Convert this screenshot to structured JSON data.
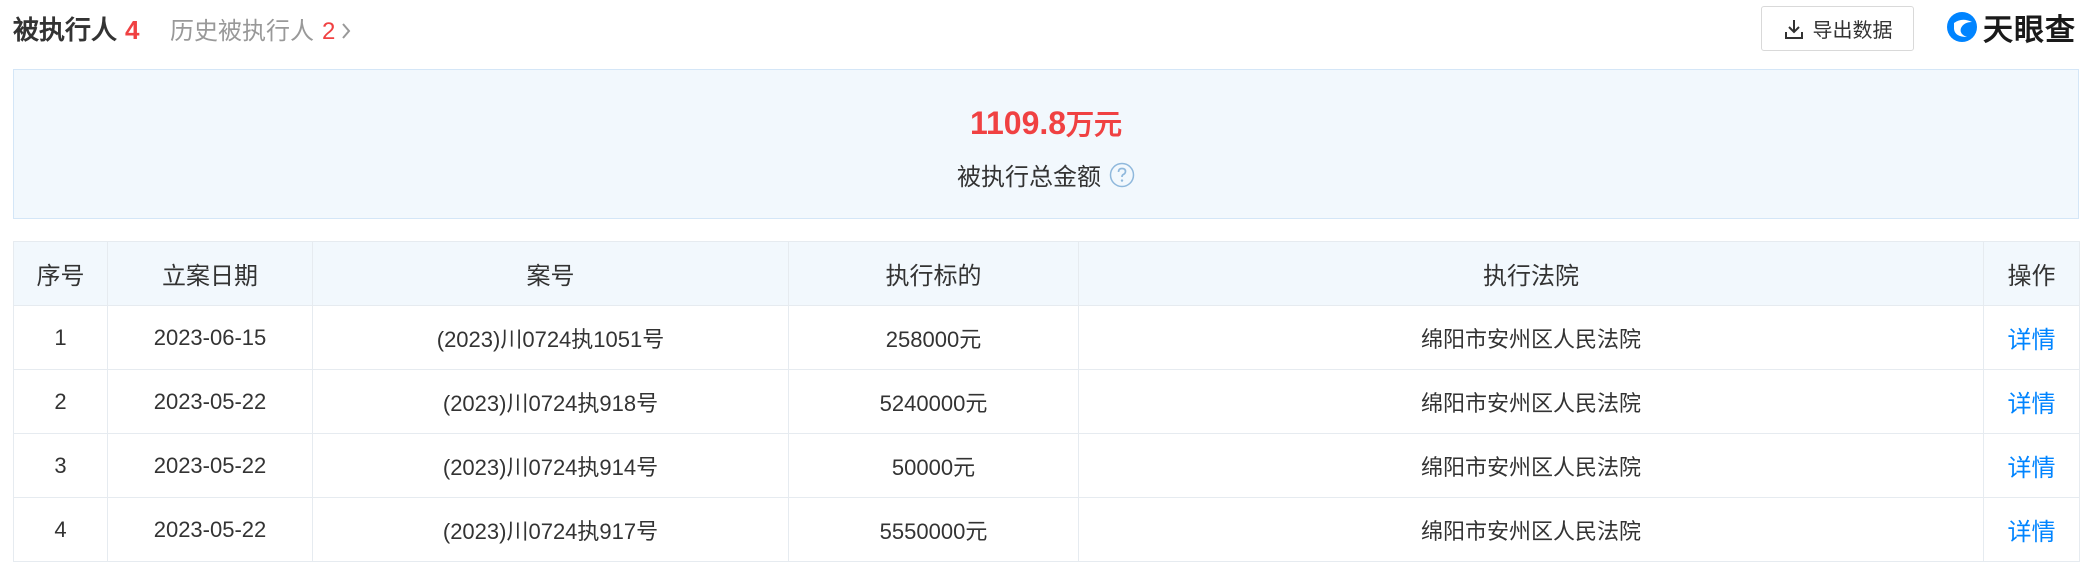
{
  "header": {
    "title": "被执行人",
    "title_count": "4",
    "history_label": "历史被执行人",
    "history_count": "2",
    "export_label": "导出数据",
    "logo_text": "天眼查"
  },
  "summary": {
    "amount": "1109.8",
    "unit": "万元",
    "label": "被执行总金额"
  },
  "table": {
    "columns": [
      "序号",
      "立案日期",
      "案号",
      "执行标的",
      "执行法院",
      "操作"
    ],
    "rows": [
      {
        "index": "1",
        "date": "2023-06-15",
        "case_no": "(2023)川0724执1051号",
        "amount": "258000元",
        "court": "绵阳市安州区人民法院",
        "action": "详情"
      },
      {
        "index": "2",
        "date": "2023-05-22",
        "case_no": "(2023)川0724执918号",
        "amount": "5240000元",
        "court": "绵阳市安州区人民法院",
        "action": "详情"
      },
      {
        "index": "3",
        "date": "2023-05-22",
        "case_no": "(2023)川0724执914号",
        "amount": "50000元",
        "court": "绵阳市安州区人民法院",
        "action": "详情"
      },
      {
        "index": "4",
        "date": "2023-05-22",
        "case_no": "(2023)川0724执917号",
        "amount": "5550000元",
        "court": "绵阳市安州区人民法院",
        "action": "详情"
      }
    ]
  },
  "icons": {
    "export": "download-icon",
    "help": "question-circle-icon",
    "chevron": "chevron-right-icon",
    "logo": "tianyancha-logo-icon"
  },
  "colors": {
    "accent_red": "#f04142",
    "link_blue": "#0084ff",
    "header_bg": "#f2f8fd"
  }
}
